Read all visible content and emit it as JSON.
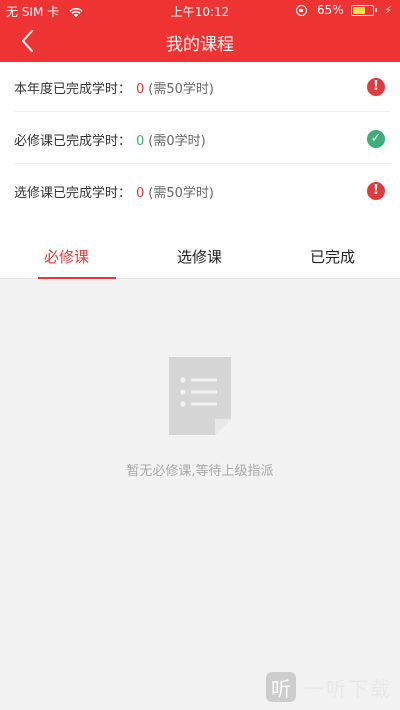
{
  "status_bar": {
    "carrier": "无 SIM 卡",
    "time": "上午10:12",
    "battery_percent": "65%",
    "battery_level": 0.65,
    "icons": [
      "wifi-icon",
      "rotation-lock-icon",
      "battery-icon",
      "charging-icon"
    ]
  },
  "header": {
    "title": "我的课程",
    "back_icon": "chevron-left-icon",
    "color": "#ee3333"
  },
  "summary": [
    {
      "label": "本年度已完成学时：",
      "value": "0",
      "requirement": "(需50学时)",
      "status": "warning",
      "status_symbol": "!"
    },
    {
      "label": "必修课已完成学时：",
      "value": "0",
      "requirement": "(需0学时)",
      "status": "complete",
      "status_symbol": "✓"
    },
    {
      "label": "选修课已完成学时：",
      "value": "0",
      "requirement": "(需50学时)",
      "status": "warning",
      "status_symbol": "!"
    }
  ],
  "tabs": [
    {
      "label": "必修课",
      "active": true
    },
    {
      "label": "选修课",
      "active": false
    },
    {
      "label": "已完成",
      "active": false
    }
  ],
  "empty_state": {
    "icon": "document-icon",
    "message": "暂无必修课,等待上级指派"
  },
  "watermark": {
    "logo_char": "听",
    "text": "一听下载"
  },
  "colors": {
    "accent": "#ee3333",
    "alert_red": "#e03a3a",
    "success_green": "#3dad7a"
  }
}
